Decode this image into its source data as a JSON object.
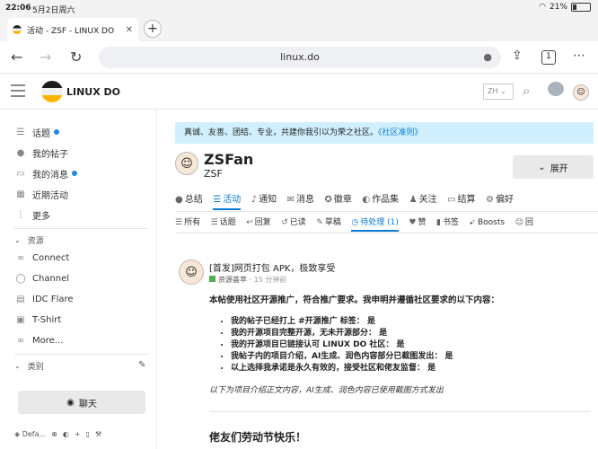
{
  "status": {
    "time": "22:06",
    "date": "5月2日周六",
    "battery": "21%",
    "battery_level": 0.21
  },
  "browser": {
    "tab_title": "活动 - ZSF - LINUX DO",
    "url": "linux.do",
    "tab_count": "1"
  },
  "header": {
    "brand": "LINUX DO",
    "lang": "ZH"
  },
  "sidebar": {
    "items": [
      {
        "label": "话题",
        "icon": "layers-icon",
        "dot": true
      },
      {
        "label": "我的帖子",
        "icon": "user-icon",
        "dot": false
      },
      {
        "label": "我的消息",
        "icon": "inbox-icon",
        "dot": true
      },
      {
        "label": "近期活动",
        "icon": "calendar-icon",
        "dot": false
      },
      {
        "label": "更多",
        "icon": "more-icon",
        "dot": false
      }
    ],
    "resources_label": "资源",
    "resources": [
      {
        "label": "Connect",
        "icon": "link-icon"
      },
      {
        "label": "Channel",
        "icon": "chat-icon"
      },
      {
        "label": "IDC Flare",
        "icon": "server-icon"
      },
      {
        "label": "T-Shirt",
        "icon": "shirt-icon"
      },
      {
        "label": "More...",
        "icon": "infinity-icon"
      }
    ],
    "categories_label": "类别",
    "chat_button": "聊天",
    "footer_label": "Defa..."
  },
  "main": {
    "banner": "真诚、友善、团结、专业，共建你我引以为荣之社区。",
    "banner_link": "《社区准则》",
    "profile_name": "ZSFan",
    "profile_user": "ZSF",
    "expand_button": "展开",
    "tabs": [
      {
        "label": "总结",
        "icon": "user-icon",
        "active": false
      },
      {
        "label": "活动",
        "icon": "stream-icon",
        "active": true
      },
      {
        "label": "通知",
        "icon": "bell-icon",
        "active": false
      },
      {
        "label": "消息",
        "icon": "envelope-icon",
        "active": false
      },
      {
        "label": "徽章",
        "icon": "badge-icon",
        "active": false
      },
      {
        "label": "作品集",
        "icon": "palette-icon",
        "active": false
      },
      {
        "label": "关注",
        "icon": "users-icon",
        "active": false
      },
      {
        "label": "结算",
        "icon": "card-icon",
        "active": false
      },
      {
        "label": "偏好",
        "icon": "gear-icon",
        "active": false
      }
    ],
    "subtabs": [
      {
        "label": "所有",
        "icon": "list-icon",
        "active": false
      },
      {
        "label": "话题",
        "icon": "list-icon",
        "active": false
      },
      {
        "label": "回复",
        "icon": "reply-icon",
        "active": false
      },
      {
        "label": "已读",
        "icon": "history-icon",
        "active": false
      },
      {
        "label": "草稿",
        "icon": "pencil-icon",
        "active": false
      },
      {
        "label": "待处理 (1)",
        "icon": "clock-icon",
        "active": true
      },
      {
        "label": "赞",
        "icon": "heart-icon",
        "active": false
      },
      {
        "label": "书签",
        "icon": "bookmark-icon",
        "active": false
      },
      {
        "label": "Boosts",
        "icon": "rocket-icon",
        "active": false
      },
      {
        "label": "回",
        "icon": "smile-icon",
        "active": false
      }
    ],
    "post": {
      "title": "[首发]网页打包 APK，极致享受",
      "category": "资源荟萃",
      "ago": "15 分钟前",
      "lead": "本帖使用社区开源推广，符合推广要求。我申明并遵循社区要求的以下内容：",
      "bullets": [
        "我的帖子已经打上 #开源推广 标签： 是",
        "我的开源项目完整开源，无未开源部分： 是",
        "我的开源项目已链接认可 LINUX DO 社区： 是",
        "我帖子内的项目介绍，AI生成、润色内容部分已截图发出： 是",
        "以上选择我承诺是永久有效的，接受社区和佬友监督： 是"
      ],
      "note": "以下为项目介绍正文内容，AI生成、润色内容已使用截图方式发出",
      "heading": "佬友们劳动节快乐！"
    }
  }
}
